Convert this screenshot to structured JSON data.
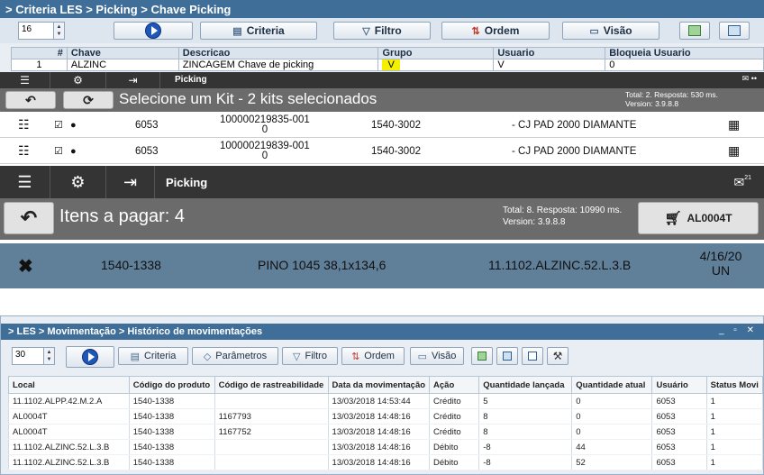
{
  "p1": {
    "breadcrumb": "> Criteria LES > Picking > Chave Picking",
    "rows_per_page": "16",
    "buttons": {
      "criteria": "Criteria",
      "filtro": "Filtro",
      "ordem": "Ordem",
      "visao": "Visão"
    },
    "columns": [
      "#",
      "Chave",
      "Descricao",
      "Grupo",
      "Usuario",
      "Bloqueia Usuario"
    ],
    "rows": [
      {
        "num": "1",
        "chave": "ALZINC",
        "descricao": "ZINCAGEM Chave de picking",
        "grupo": "V",
        "usuario": "V",
        "bloqueia": "0"
      }
    ]
  },
  "p2": {
    "menu_title": "Picking",
    "heading": "Selecione um Kit - 2 kits selecionados",
    "status_line1": "Total: 2. Resposta: 530 ms.",
    "status_line2": "Version: 3.9.8.8",
    "notif": "••",
    "rows": [
      {
        "user": "6053",
        "code": "100000219835-001",
        "code2": "0",
        "part": "1540-3002",
        "desc": "- CJ PAD 2000 DIAMANTE"
      },
      {
        "user": "6053",
        "code": "100000219839-001",
        "code2": "0",
        "part": "1540-3002",
        "desc": "- CJ PAD 2000 DIAMANTE"
      }
    ]
  },
  "p3": {
    "menu_title": "Picking",
    "notif": "21",
    "heading": "Itens a pagar: 4",
    "status_line1": "Total: 8. Resposta: 10990 ms.",
    "status_line2": "Version: 3.9.8.8",
    "cart_label": "AL0004T",
    "item": {
      "part": "1540-1338",
      "desc": "PINO 1045 38,1x134,6",
      "location": "11.1102.ALZINC.52.L.3.B",
      "date": "4/16/20",
      "unit": "UN"
    }
  },
  "p4": {
    "breadcrumb": "> LES > Movimentação > Histórico de movimentações",
    "rows_per_page": "30",
    "buttons": {
      "criteria": "Criteria",
      "parametros": "Parâmetros",
      "filtro": "Filtro",
      "ordem": "Ordem",
      "visao": "Visão"
    },
    "columns": [
      "Local",
      "Código do produto",
      "Código de rastreabilidade",
      "Data da movimentação",
      "Ação",
      "Quantidade lançada",
      "Quantidade atual",
      "Usuário",
      "Status Movi"
    ],
    "rows": [
      [
        "11.1102.ALPP.42.M.2.A",
        "1540-1338",
        "",
        "13/03/2018 14:53:44",
        "Crédito",
        "5",
        "0",
        "6053",
        "1"
      ],
      [
        "AL0004T",
        "1540-1338",
        "1167793",
        "13/03/2018 14:48:16",
        "Crédito",
        "8",
        "0",
        "6053",
        "1"
      ],
      [
        "AL0004T",
        "1540-1338",
        "1167752",
        "13/03/2018 14:48:16",
        "Crédito",
        "8",
        "0",
        "6053",
        "1"
      ],
      [
        "11.1102.ALZINC.52.L.3.B",
        "1540-1338",
        "",
        "13/03/2018 14:48:16",
        "Débito",
        "-8",
        "44",
        "6053",
        "1"
      ],
      [
        "11.1102.ALZINC.52.L.3.B",
        "1540-1338",
        "",
        "13/03/2018 14:48:16",
        "Débito",
        "-8",
        "52",
        "6053",
        "1"
      ]
    ]
  },
  "colors": {
    "header_blue": "#3f6e98",
    "dark_bar": "#343434",
    "grey_bar": "#6b6b6b",
    "item_bar": "#607f99",
    "highlight_yellow": "#f4f000",
    "play_blue": "#1f57b8"
  }
}
